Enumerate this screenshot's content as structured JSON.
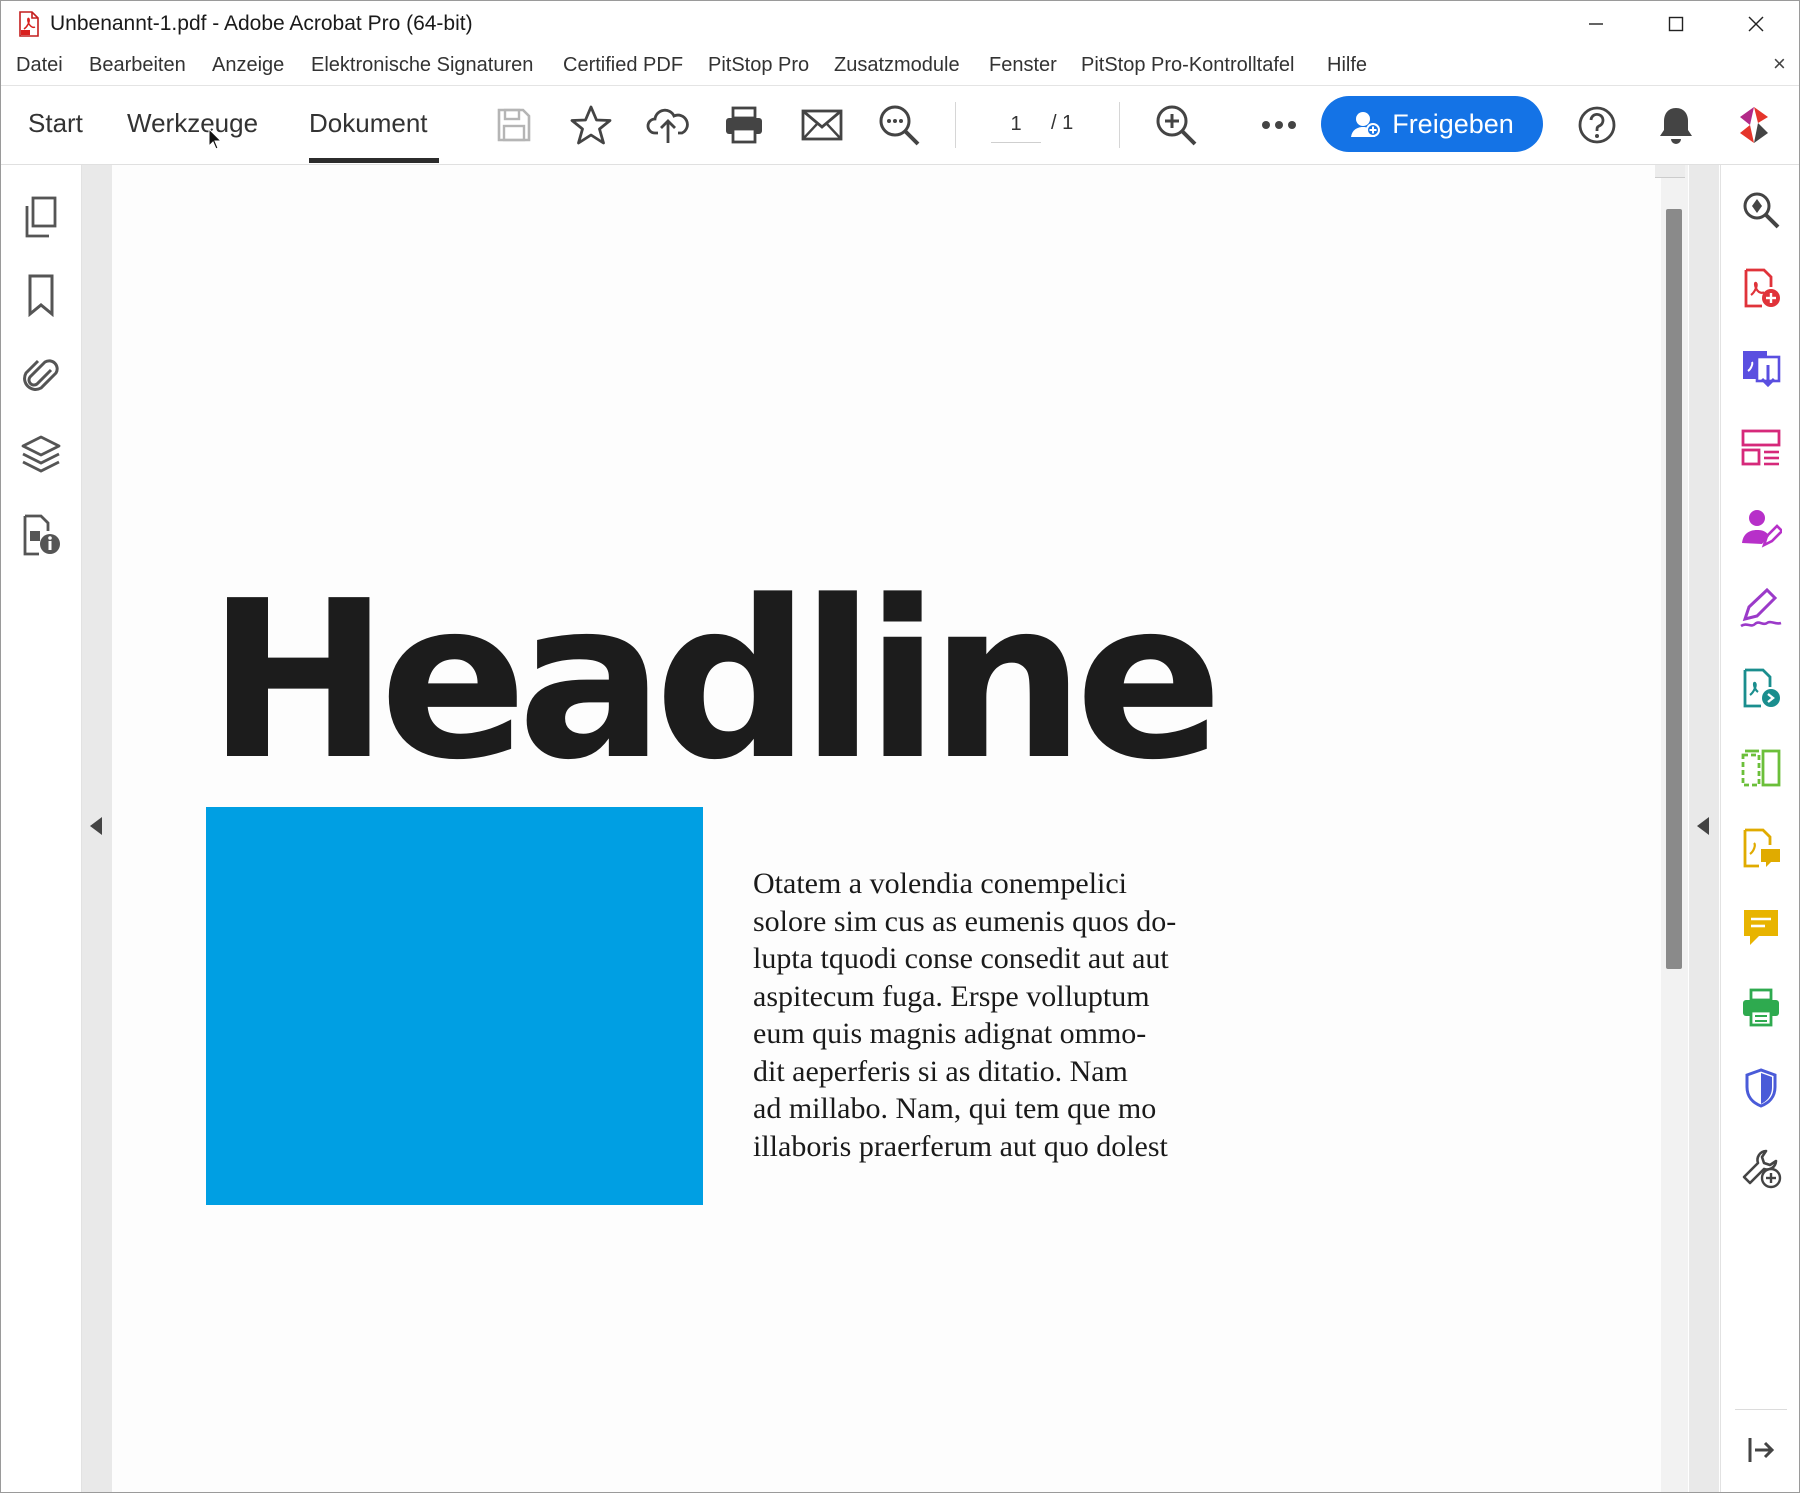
{
  "window": {
    "title": "Unbenannt-1.pdf - Adobe Acrobat Pro (64-bit)",
    "app_icon": "acrobat-pdf-icon",
    "controls": [
      "minimize-icon",
      "maximize-icon",
      "close-icon"
    ]
  },
  "menubar": {
    "items": [
      "Datei",
      "Bearbeiten",
      "Anzeige",
      "Elektronische Signaturen",
      "Certified PDF",
      "PitStop Pro",
      "Zusatzmodule",
      "Fenster",
      "PitStop Pro-Kontrolltafel",
      "Hilfe"
    ],
    "close_glyph": "×"
  },
  "toolbar": {
    "tabs": [
      "Start",
      "Werkzeuge",
      "Dokument"
    ],
    "active_tab": "Dokument",
    "icons": [
      "save-icon",
      "bookmark-star-icon",
      "upload-cloud-icon",
      "print-icon",
      "email-icon",
      "find-text-icon",
      "zoom-in-icon",
      "more-options-icon",
      "help-icon",
      "notifications-icon",
      "adobe-account-icon"
    ],
    "page_current": "1",
    "page_total": "/  1",
    "share_label": "Freigeben",
    "share_color": "#1473e6"
  },
  "left_rail": {
    "icons": [
      "page-thumbnails-icon",
      "bookmarks-icon",
      "attachments-icon",
      "layers-icon",
      "document-properties-icon"
    ]
  },
  "document": {
    "headline": "Headline",
    "box_color": "#009fe3",
    "body_lines": [
      "Otatem a volendia conempelici",
      "solore sim cus as eumenis quos do-",
      "lupta tquodi conse consedit aut aut",
      "aspitecum fuga. Erspe volluptum",
      "eum quis magnis adignat ommo-",
      "dit aeperferis si as ditatio. Nam",
      "ad millabo. Nam, qui tem que mo",
      "illaboris praerferum aut quo dolest"
    ]
  },
  "right_rail": {
    "icons": [
      "zoom-find-icon",
      "create-pdf-icon",
      "export-pdf-icon",
      "organize-pages-icon",
      "request-signature-icon",
      "fill-sign-icon",
      "send-for-review-icon",
      "compare-files-icon",
      "comment-file-icon",
      "comment-icon",
      "print-production-icon",
      "protect-icon",
      "more-tools-icon",
      "collapse-panel-icon"
    ]
  }
}
